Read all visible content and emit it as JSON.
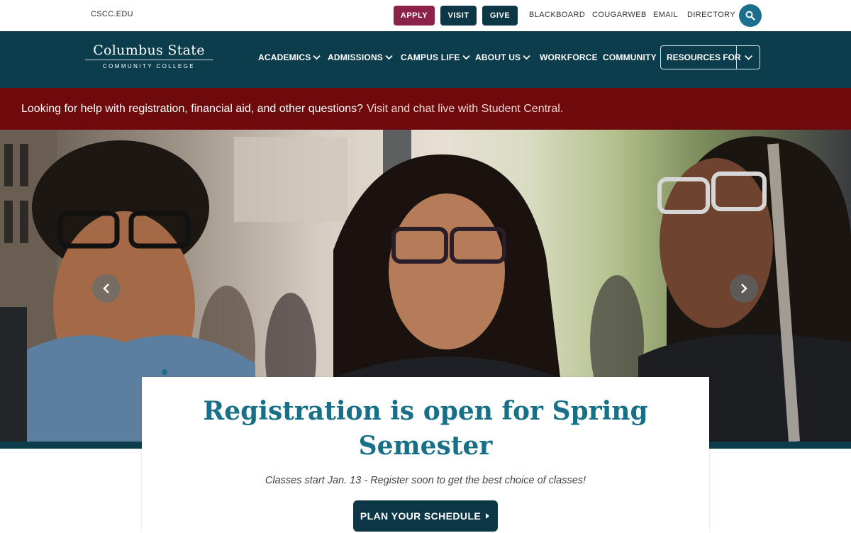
{
  "utility": {
    "site_link": "CSCC.EDU",
    "apply_label": "APPLY",
    "visit_label": "VISIT",
    "give_label": "GIVE",
    "links": [
      "BLACKBOARD",
      "COUGARWEB",
      "EMAIL",
      "DIRECTORY"
    ],
    "search_icon": "search-icon"
  },
  "logo": {
    "name_top": "Columbus State",
    "name_bottom": "COMMUNITY COLLEGE"
  },
  "nav": {
    "items": [
      {
        "label": "ACADEMICS",
        "has_dropdown": true
      },
      {
        "label": "ADMISSIONS",
        "has_dropdown": true
      },
      {
        "label": "CAMPUS LIFE",
        "has_dropdown": true
      },
      {
        "label": "ABOUT US",
        "has_dropdown": true
      },
      {
        "label": "WORKFORCE",
        "has_dropdown": false
      },
      {
        "label": "COMMUNITY",
        "has_dropdown": false
      }
    ],
    "resources_label": "RESOURCES FOR"
  },
  "alert": {
    "text": "Looking for help with registration, financial aid, and other questions?",
    "link_text": "Visit and chat live with Student Central."
  },
  "hero": {
    "prev_icon": "chevron-left-icon",
    "next_icon": "chevron-right-icon",
    "slide_count_visible": 1
  },
  "card": {
    "title": "Registration is open for Spring Semester",
    "subtitle": "Classes start Jan. 13 - Register soon to get the best choice of classes!",
    "cta_label": "PLAN YOUR SCHEDULE"
  },
  "colors": {
    "nav_bg": "#0b3d4d",
    "apply_bg": "#8b2249",
    "alert_bg": "#6e0a0c",
    "accent": "#177087"
  }
}
